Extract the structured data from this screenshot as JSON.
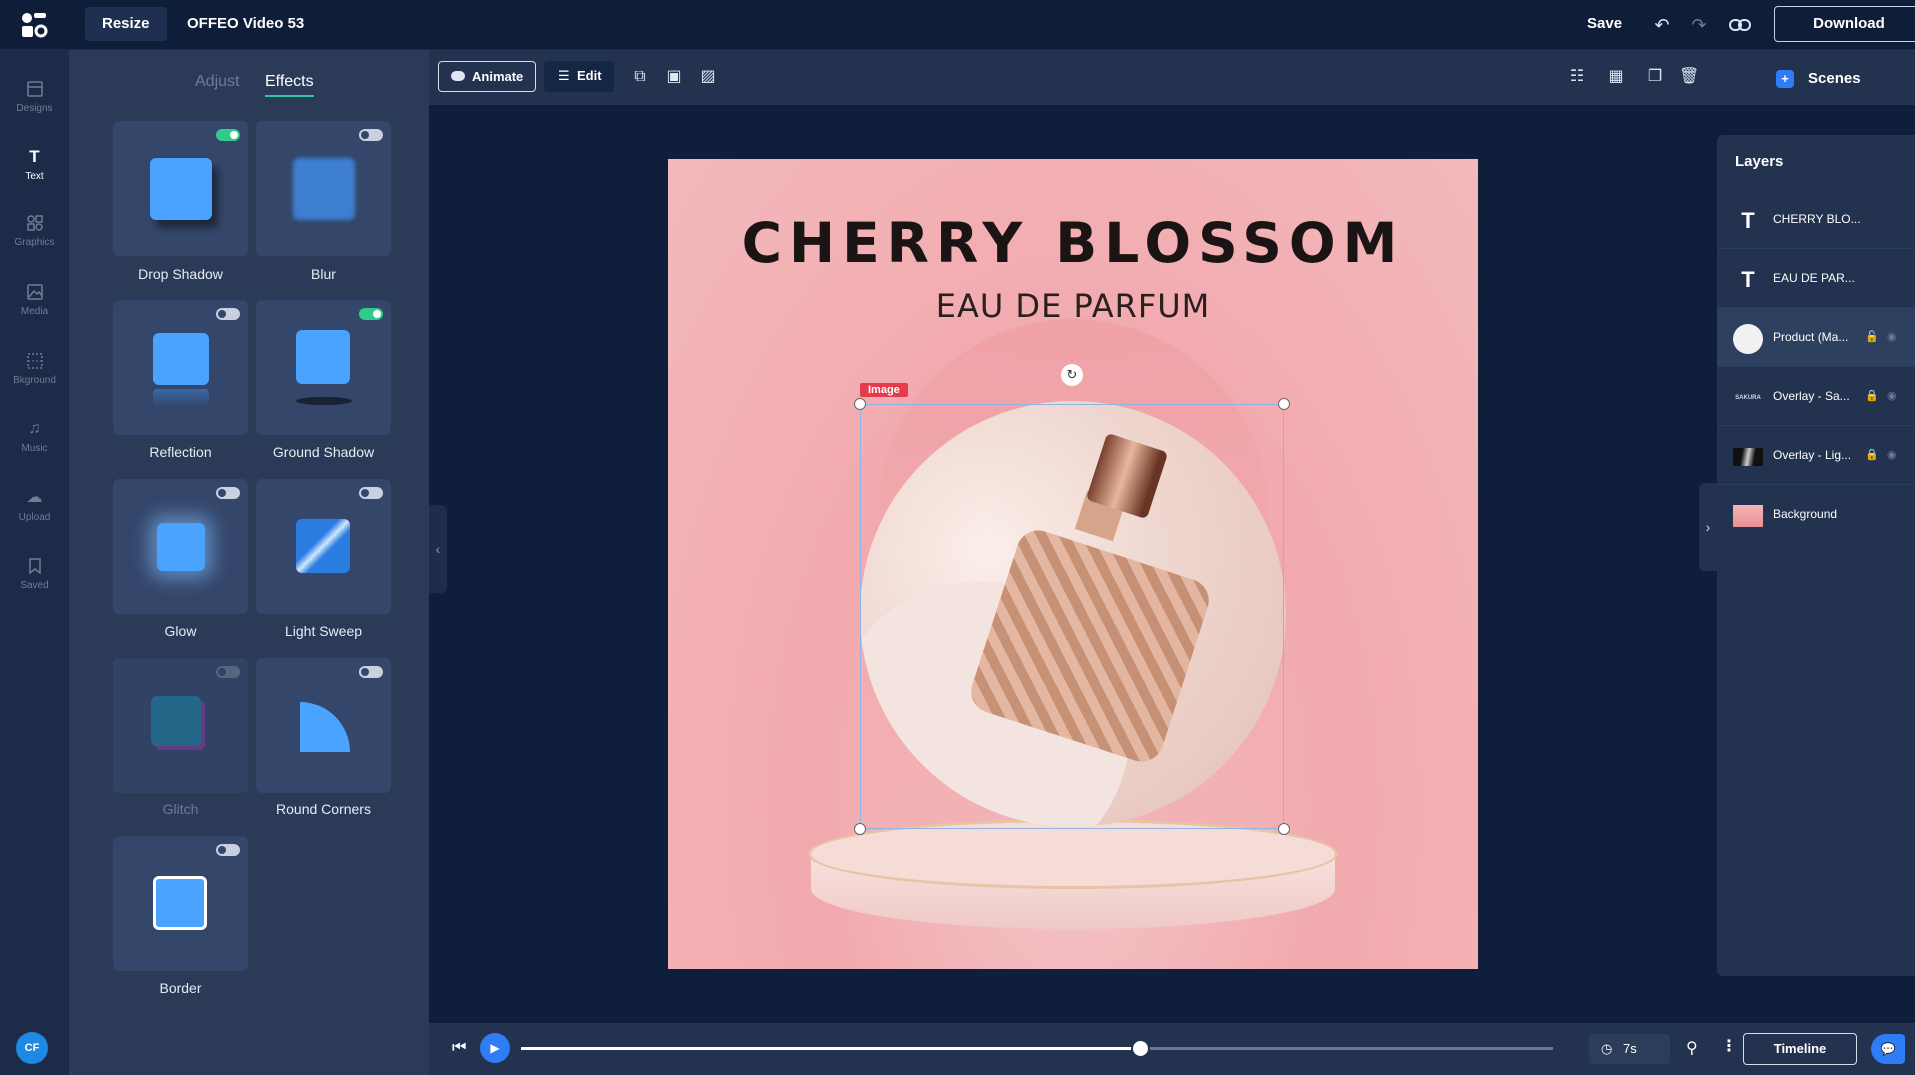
{
  "topbar": {
    "resize_label": "Resize",
    "doc_title": "OFFEO Video 53",
    "save_label": "Save",
    "download_label": "Download"
  },
  "rail": {
    "items": [
      {
        "label": "Designs",
        "icon": "designs-icon"
      },
      {
        "label": "Text",
        "icon": "text-icon"
      },
      {
        "label": "Graphics",
        "icon": "graphics-icon"
      },
      {
        "label": "Media",
        "icon": "media-icon"
      },
      {
        "label": "Bkground",
        "icon": "background-icon"
      },
      {
        "label": "Music",
        "icon": "music-icon"
      },
      {
        "label": "Upload",
        "icon": "upload-icon"
      },
      {
        "label": "Saved",
        "icon": "saved-icon"
      }
    ],
    "avatar_initials": "CF"
  },
  "panel": {
    "tab_adjust": "Adjust",
    "tab_effects": "Effects",
    "effects": [
      {
        "label": "Drop Shadow",
        "on": true
      },
      {
        "label": "Blur",
        "on": false
      },
      {
        "label": "Reflection",
        "on": false
      },
      {
        "label": "Ground Shadow",
        "on": true
      },
      {
        "label": "Glow",
        "on": false
      },
      {
        "label": "Light Sweep",
        "on": false
      },
      {
        "label": "Glitch",
        "on": false,
        "disabled": true
      },
      {
        "label": "Round Corners",
        "on": false
      },
      {
        "label": "Border",
        "on": false
      }
    ]
  },
  "toolbar": {
    "animate_label": "Animate",
    "edit_label": "Edit",
    "scenes_label": "Scenes"
  },
  "artboard": {
    "title": "CHERRY BLOSSOM",
    "subtitle": "EAU DE PARFUM",
    "selection_tag": "Image"
  },
  "layers": {
    "title": "Layers",
    "items": [
      {
        "name": "CHERRY BLO...",
        "kind": "text"
      },
      {
        "name": "EAU DE PAR...",
        "kind": "text"
      },
      {
        "name": "Product (Ma...",
        "kind": "image",
        "active": true
      },
      {
        "name": "Overlay - Sa...",
        "kind": "overlay",
        "thumb_text": "SAKURA"
      },
      {
        "name": "Overlay - Lig...",
        "kind": "overlay"
      },
      {
        "name": "Background",
        "kind": "image"
      }
    ]
  },
  "bottombar": {
    "duration": "7s",
    "timeline_label": "Timeline",
    "progress": 0.6
  },
  "colors": {
    "accent": "#2f7df6",
    "toggle_on": "#2ecc8a",
    "tag": "#e53b4b"
  }
}
